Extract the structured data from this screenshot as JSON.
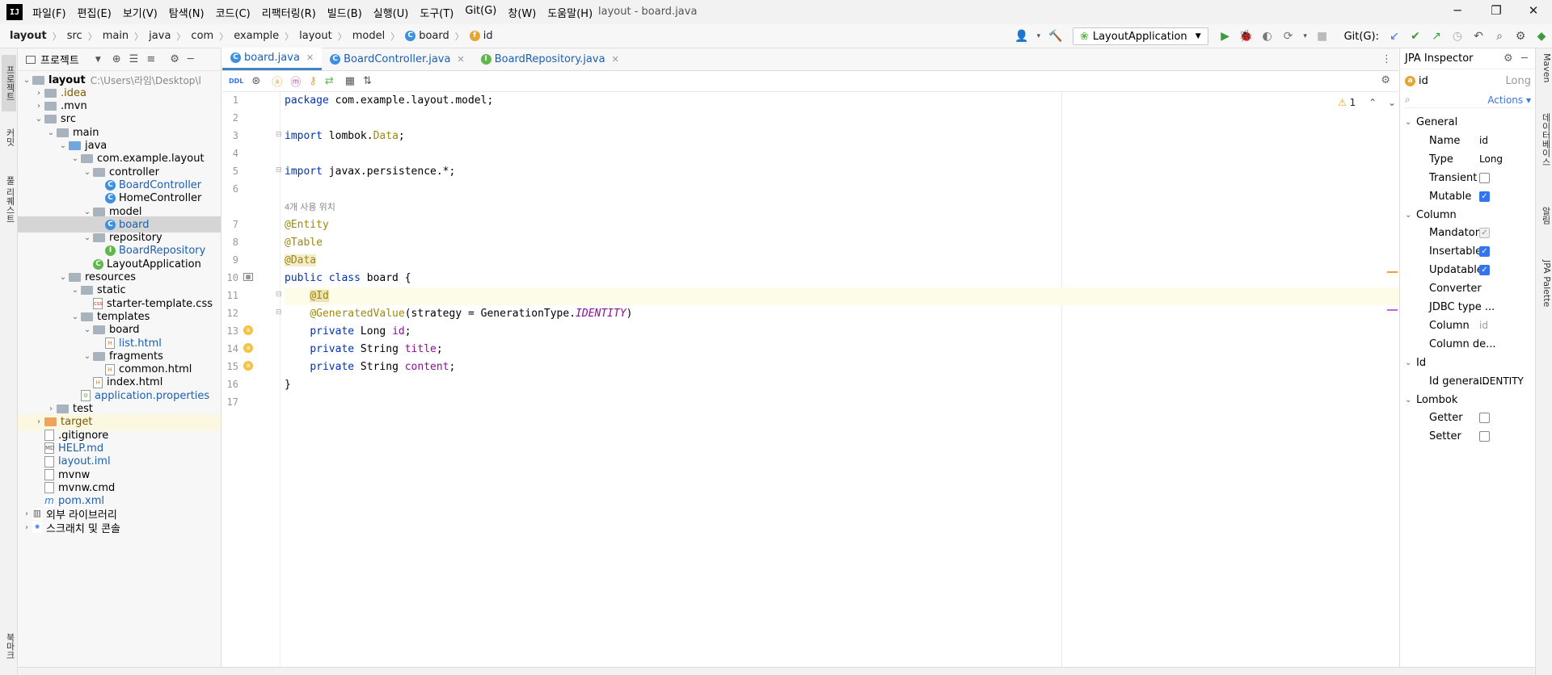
{
  "menubar": {
    "app_icon": "IJ",
    "items": [
      "파일(F)",
      "편집(E)",
      "보기(V)",
      "탐색(N)",
      "코드(C)",
      "리팩터링(R)",
      "빌드(B)",
      "실행(U)",
      "도구(T)",
      "Git(G)",
      "창(W)",
      "도움말(H)"
    ],
    "window_title": "layout - board.java",
    "minimize": "─",
    "restore": "❐",
    "close": "✕"
  },
  "breadcrumb": {
    "items": [
      "layout",
      "src",
      "main",
      "java",
      "com",
      "example",
      "layout",
      "model"
    ],
    "class_item": "board",
    "field_item": "id",
    "separator": "〉"
  },
  "toolbar": {
    "run_config": "LayoutApplication",
    "git_label": "Git(G):"
  },
  "left_stripe": {
    "tabs": [
      "프로젝트",
      "커밋",
      "풀 리퀘스트",
      "북마크"
    ]
  },
  "project": {
    "title": "프로젝트",
    "tree": [
      {
        "label": "layout",
        "extra": "C:\\Users\\라임\\Desktop\\l",
        "depth": 0,
        "open": true,
        "type": "module",
        "bold": true
      },
      {
        "label": ".idea",
        "depth": 1,
        "open": false,
        "type": "folder",
        "color": "#7d5a00"
      },
      {
        "label": ".mvn",
        "depth": 1,
        "open": false,
        "type": "folder"
      },
      {
        "label": "src",
        "depth": 1,
        "open": true,
        "type": "folder"
      },
      {
        "label": "main",
        "depth": 2,
        "open": true,
        "type": "folder"
      },
      {
        "label": "java",
        "depth": 3,
        "open": true,
        "type": "folder-blue"
      },
      {
        "label": "com.example.layout",
        "depth": 4,
        "open": true,
        "type": "package"
      },
      {
        "label": "controller",
        "depth": 5,
        "open": true,
        "type": "package"
      },
      {
        "label": "BoardController",
        "depth": 6,
        "type": "class",
        "color": "#1a5fb4"
      },
      {
        "label": "HomeController",
        "depth": 6,
        "type": "class"
      },
      {
        "label": "model",
        "depth": 5,
        "open": true,
        "type": "package"
      },
      {
        "label": "board",
        "depth": 6,
        "type": "class",
        "color": "#1a5fb4",
        "selected": true
      },
      {
        "label": "repository",
        "depth": 5,
        "open": true,
        "type": "package"
      },
      {
        "label": "BoardRepository",
        "depth": 6,
        "type": "interface",
        "color": "#1a5fb4"
      },
      {
        "label": "LayoutApplication",
        "depth": 5,
        "type": "app"
      },
      {
        "label": "resources",
        "depth": 3,
        "open": true,
        "type": "folder"
      },
      {
        "label": "static",
        "depth": 4,
        "open": true,
        "type": "folder"
      },
      {
        "label": "starter-template.css",
        "depth": 5,
        "type": "css"
      },
      {
        "label": "templates",
        "depth": 4,
        "open": true,
        "type": "folder"
      },
      {
        "label": "board",
        "depth": 5,
        "open": true,
        "type": "folder"
      },
      {
        "label": "list.html",
        "depth": 6,
        "type": "html",
        "color": "#1a5fb4"
      },
      {
        "label": "fragments",
        "depth": 5,
        "open": true,
        "type": "folder"
      },
      {
        "label": "common.html",
        "depth": 6,
        "type": "html"
      },
      {
        "label": "index.html",
        "depth": 5,
        "type": "html"
      },
      {
        "label": "application.properties",
        "depth": 4,
        "type": "props",
        "color": "#1a5fb4"
      },
      {
        "label": "test",
        "depth": 2,
        "open": false,
        "type": "folder"
      },
      {
        "label": "target",
        "depth": 1,
        "open": false,
        "type": "folder-orange",
        "color": "#7d5a00",
        "target": true
      },
      {
        "label": ".gitignore",
        "depth": 1,
        "type": "file"
      },
      {
        "label": "HELP.md",
        "depth": 1,
        "type": "md",
        "color": "#1a5fb4"
      },
      {
        "label": "layout.iml",
        "depth": 1,
        "type": "iml",
        "color": "#1a5fb4"
      },
      {
        "label": "mvnw",
        "depth": 1,
        "type": "file"
      },
      {
        "label": "mvnw.cmd",
        "depth": 1,
        "type": "file"
      },
      {
        "label": "pom.xml",
        "depth": 1,
        "type": "maven",
        "color": "#1a5fb4"
      },
      {
        "label": "외부 라이브러리",
        "depth": 0,
        "open": false,
        "type": "lib"
      },
      {
        "label": "스크래치 및 콘솔",
        "depth": 0,
        "open": false,
        "type": "scratch"
      }
    ]
  },
  "editor": {
    "tabs": [
      {
        "label": "board.java",
        "icon": "C",
        "active": true
      },
      {
        "label": "BoardController.java",
        "icon": "C",
        "active": false
      },
      {
        "label": "BoardRepository.java",
        "icon": "I",
        "active": false
      }
    ],
    "warning_count": "1",
    "usage_hint": "4개 사용 위치",
    "lines": [
      {
        "n": "1",
        "html": "<span class=\"kw\">package</span> com.example.layout.model;"
      },
      {
        "n": "2",
        "html": ""
      },
      {
        "n": "3",
        "html": "<span class=\"kw\">import</span> lombok.<span class=\"ann\">Data</span>;"
      },
      {
        "n": "4",
        "html": ""
      },
      {
        "n": "5",
        "html": "<span class=\"kw\">import</span> javax.persistence.*;"
      },
      {
        "n": "6",
        "html": ""
      },
      {
        "n": "",
        "html": "<span class=\"hint\">4개 사용 위치</span>"
      },
      {
        "n": "7",
        "html": "<span class=\"ann\">@Entity</span>"
      },
      {
        "n": "8",
        "html": "<span class=\"ann\">@Table</span>"
      },
      {
        "n": "9",
        "html": "<span class=\"ann\" style=\"background:#f5eccc\">@Data</span>"
      },
      {
        "n": "10",
        "html": "<span class=\"kw\">public class</span> board {"
      },
      {
        "n": "11",
        "html": "    <span class=\"ann\" style=\"background:#ece3b8\">@Id</span>",
        "current": true
      },
      {
        "n": "12",
        "html": "    <span class=\"ann\">@GeneratedValue</span>(strategy = GenerationType.<span class=\"it\">IDENTITY</span>)"
      },
      {
        "n": "13",
        "html": "    <span class=\"kw\">private</span> Long <span class=\"fld\">id</span>;"
      },
      {
        "n": "14",
        "html": "    <span class=\"kw\">private</span> String <span class=\"fld\">title</span>;"
      },
      {
        "n": "15",
        "html": "    <span class=\"kw\">private</span> String <span class=\"fld\">content</span>;"
      },
      {
        "n": "16",
        "html": "}"
      },
      {
        "n": "17",
        "html": ""
      }
    ]
  },
  "inspector": {
    "title": "JPA Inspector",
    "entity_name": "id",
    "entity_type": "Long",
    "search_placeholder": "",
    "actions_label": "Actions",
    "rows": [
      {
        "kind": "section",
        "label": "General"
      },
      {
        "kind": "text",
        "label": "Name",
        "value": "id"
      },
      {
        "kind": "text",
        "label": "Type",
        "value": "Long"
      },
      {
        "kind": "check",
        "label": "Transient",
        "checked": false
      },
      {
        "kind": "check",
        "label": "Mutable",
        "checked": true
      },
      {
        "kind": "section",
        "label": "Column"
      },
      {
        "kind": "check",
        "label": "Mandatory",
        "checked": true,
        "disabled": true
      },
      {
        "kind": "check",
        "label": "Insertable",
        "checked": true
      },
      {
        "kind": "check",
        "label": "Updatable",
        "checked": true
      },
      {
        "kind": "text",
        "label": "Converter",
        "value": ""
      },
      {
        "kind": "text",
        "label": "JDBC type ...",
        "value": ""
      },
      {
        "kind": "text",
        "label": "Column",
        "value": "id",
        "muted": true
      },
      {
        "kind": "text",
        "label": "Column de...",
        "value": ""
      },
      {
        "kind": "section",
        "label": "Id"
      },
      {
        "kind": "text",
        "label": "Id genera...",
        "value": "IDENTITY"
      },
      {
        "kind": "section",
        "label": "Lombok"
      },
      {
        "kind": "check",
        "label": "Getter",
        "checked": false
      },
      {
        "kind": "check",
        "label": "Setter",
        "checked": false
      }
    ]
  },
  "right_stripe": {
    "tabs": [
      "Maven",
      "데이터베이스",
      "알림",
      "JPA Palette"
    ]
  }
}
